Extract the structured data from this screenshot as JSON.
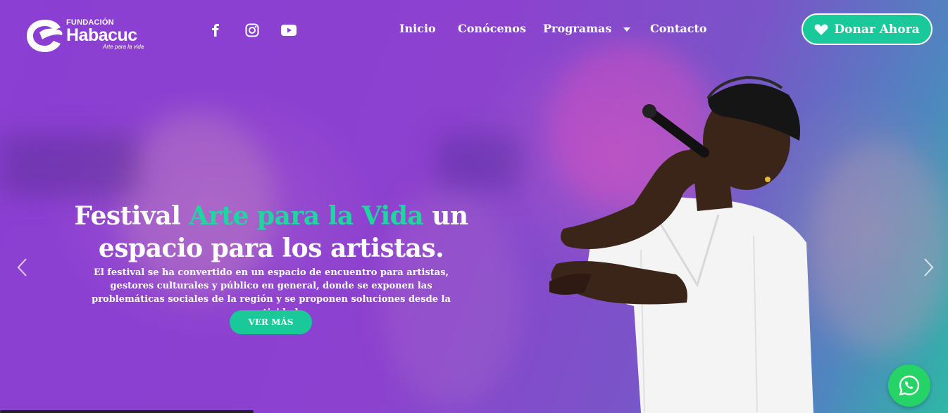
{
  "logo": {
    "small": "FUNDACIÓN",
    "big": "Habacuc",
    "tagline": "Arte para la vida"
  },
  "social": [
    {
      "name": "facebook-icon",
      "glyph": "f"
    },
    {
      "name": "instagram-icon"
    },
    {
      "name": "youtube-icon"
    }
  ],
  "nav": {
    "inicio": "Inicio",
    "conocenos": "Conócenos",
    "programas": "Programas",
    "contacto": "Contacto"
  },
  "donate": {
    "label": "Donar Ahora"
  },
  "hero": {
    "title_part1": "Festival ",
    "title_highlight": "Arte para la Vida",
    "title_part2": " un espacio para los artistas.",
    "description": "El festival se ha convertido en un espacio de encuentro para artistas, gestores culturales y público en general, donde se exponen las problemáticas sociales de la región y se proponen soluciones desde la creatividad.",
    "cta": "VER MÁS"
  },
  "colors": {
    "accent": "#19c99a",
    "highlight": "#1fd6a0",
    "whatsapp": "#25d366",
    "bg_purple": "#8b3fd3",
    "bg_teal": "#2fb7a6"
  }
}
